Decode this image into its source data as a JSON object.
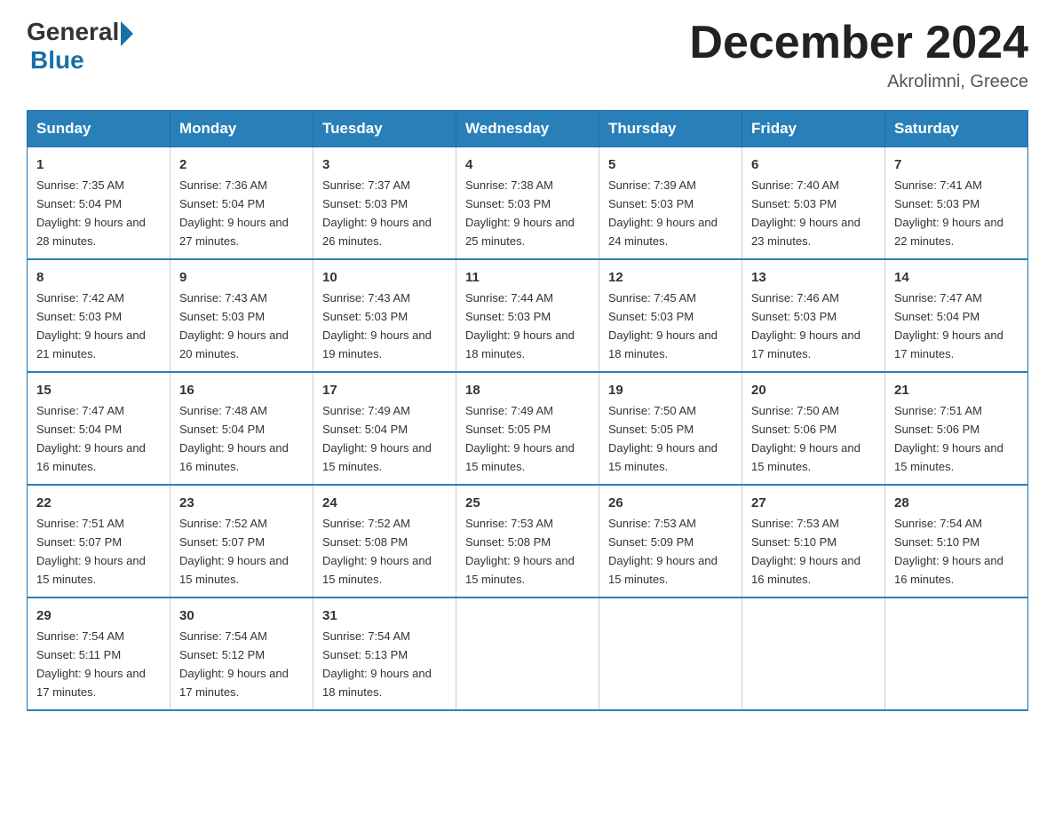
{
  "header": {
    "logo_general": "General",
    "logo_blue": "Blue",
    "title": "December 2024",
    "location": "Akrolimni, Greece"
  },
  "days_of_week": [
    "Sunday",
    "Monday",
    "Tuesday",
    "Wednesday",
    "Thursday",
    "Friday",
    "Saturday"
  ],
  "weeks": [
    [
      {
        "day": "1",
        "sunrise": "7:35 AM",
        "sunset": "5:04 PM",
        "daylight": "9 hours and 28 minutes."
      },
      {
        "day": "2",
        "sunrise": "7:36 AM",
        "sunset": "5:04 PM",
        "daylight": "9 hours and 27 minutes."
      },
      {
        "day": "3",
        "sunrise": "7:37 AM",
        "sunset": "5:03 PM",
        "daylight": "9 hours and 26 minutes."
      },
      {
        "day": "4",
        "sunrise": "7:38 AM",
        "sunset": "5:03 PM",
        "daylight": "9 hours and 25 minutes."
      },
      {
        "day": "5",
        "sunrise": "7:39 AM",
        "sunset": "5:03 PM",
        "daylight": "9 hours and 24 minutes."
      },
      {
        "day": "6",
        "sunrise": "7:40 AM",
        "sunset": "5:03 PM",
        "daylight": "9 hours and 23 minutes."
      },
      {
        "day": "7",
        "sunrise": "7:41 AM",
        "sunset": "5:03 PM",
        "daylight": "9 hours and 22 minutes."
      }
    ],
    [
      {
        "day": "8",
        "sunrise": "7:42 AM",
        "sunset": "5:03 PM",
        "daylight": "9 hours and 21 minutes."
      },
      {
        "day": "9",
        "sunrise": "7:43 AM",
        "sunset": "5:03 PM",
        "daylight": "9 hours and 20 minutes."
      },
      {
        "day": "10",
        "sunrise": "7:43 AM",
        "sunset": "5:03 PM",
        "daylight": "9 hours and 19 minutes."
      },
      {
        "day": "11",
        "sunrise": "7:44 AM",
        "sunset": "5:03 PM",
        "daylight": "9 hours and 18 minutes."
      },
      {
        "day": "12",
        "sunrise": "7:45 AM",
        "sunset": "5:03 PM",
        "daylight": "9 hours and 18 minutes."
      },
      {
        "day": "13",
        "sunrise": "7:46 AM",
        "sunset": "5:03 PM",
        "daylight": "9 hours and 17 minutes."
      },
      {
        "day": "14",
        "sunrise": "7:47 AM",
        "sunset": "5:04 PM",
        "daylight": "9 hours and 17 minutes."
      }
    ],
    [
      {
        "day": "15",
        "sunrise": "7:47 AM",
        "sunset": "5:04 PM",
        "daylight": "9 hours and 16 minutes."
      },
      {
        "day": "16",
        "sunrise": "7:48 AM",
        "sunset": "5:04 PM",
        "daylight": "9 hours and 16 minutes."
      },
      {
        "day": "17",
        "sunrise": "7:49 AM",
        "sunset": "5:04 PM",
        "daylight": "9 hours and 15 minutes."
      },
      {
        "day": "18",
        "sunrise": "7:49 AM",
        "sunset": "5:05 PM",
        "daylight": "9 hours and 15 minutes."
      },
      {
        "day": "19",
        "sunrise": "7:50 AM",
        "sunset": "5:05 PM",
        "daylight": "9 hours and 15 minutes."
      },
      {
        "day": "20",
        "sunrise": "7:50 AM",
        "sunset": "5:06 PM",
        "daylight": "9 hours and 15 minutes."
      },
      {
        "day": "21",
        "sunrise": "7:51 AM",
        "sunset": "5:06 PM",
        "daylight": "9 hours and 15 minutes."
      }
    ],
    [
      {
        "day": "22",
        "sunrise": "7:51 AM",
        "sunset": "5:07 PM",
        "daylight": "9 hours and 15 minutes."
      },
      {
        "day": "23",
        "sunrise": "7:52 AM",
        "sunset": "5:07 PM",
        "daylight": "9 hours and 15 minutes."
      },
      {
        "day": "24",
        "sunrise": "7:52 AM",
        "sunset": "5:08 PM",
        "daylight": "9 hours and 15 minutes."
      },
      {
        "day": "25",
        "sunrise": "7:53 AM",
        "sunset": "5:08 PM",
        "daylight": "9 hours and 15 minutes."
      },
      {
        "day": "26",
        "sunrise": "7:53 AM",
        "sunset": "5:09 PM",
        "daylight": "9 hours and 15 minutes."
      },
      {
        "day": "27",
        "sunrise": "7:53 AM",
        "sunset": "5:10 PM",
        "daylight": "9 hours and 16 minutes."
      },
      {
        "day": "28",
        "sunrise": "7:54 AM",
        "sunset": "5:10 PM",
        "daylight": "9 hours and 16 minutes."
      }
    ],
    [
      {
        "day": "29",
        "sunrise": "7:54 AM",
        "sunset": "5:11 PM",
        "daylight": "9 hours and 17 minutes."
      },
      {
        "day": "30",
        "sunrise": "7:54 AM",
        "sunset": "5:12 PM",
        "daylight": "9 hours and 17 minutes."
      },
      {
        "day": "31",
        "sunrise": "7:54 AM",
        "sunset": "5:13 PM",
        "daylight": "9 hours and 18 minutes."
      },
      null,
      null,
      null,
      null
    ]
  ]
}
